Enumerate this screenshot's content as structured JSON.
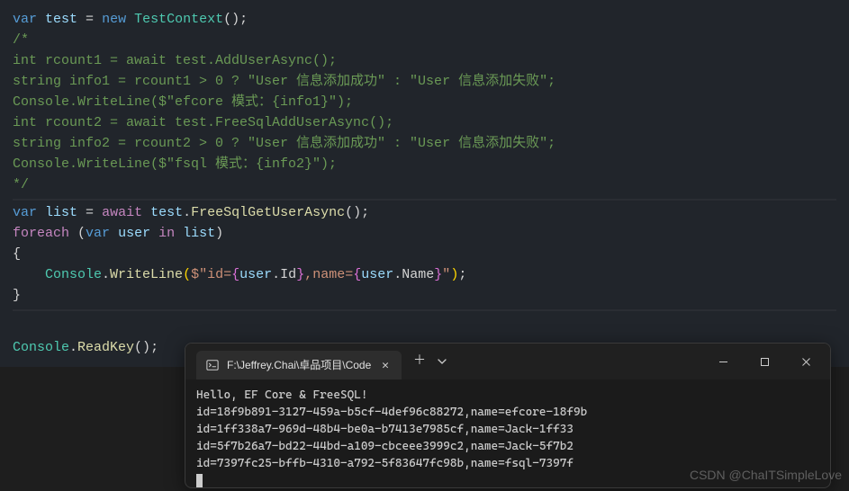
{
  "code": {
    "l1": {
      "kw_var": "var",
      "var_test": "test",
      "eq": " = ",
      "kw_new": "new",
      "cls": "TestContext",
      "parens": "()",
      "semi": ";"
    },
    "comment_open": "/*",
    "comment_lines": [
      "int rcount1 = await test.AddUserAsync();",
      "string info1 = rcount1 > 0 ? \"User 信息添加成功\" : \"User 信息添加失败\";",
      "Console.WriteLine($\"efcore 模式：{info1}\");",
      "",
      "int rcount2 = await test.FreeSqlAddUserAsync();",
      "string info2 = rcount2 > 0 ? \"User 信息添加成功\" : \"User 信息添加失败\";",
      "Console.WriteLine($\"fsql 模式：{info2}\");"
    ],
    "comment_close": "*/",
    "l_list": {
      "kw_var": "var",
      "var_list": "list",
      "eq": " = ",
      "kw_await": "await",
      "var_test": "test",
      "dot": ".",
      "method": "FreeSqlGetUserAsync",
      "parens": "()",
      "semi": ";"
    },
    "l_foreach": {
      "kw_foreach": "foreach",
      "sp": " ",
      "lp": "(",
      "kw_var": "var",
      "var_user": "user",
      "kw_in": "in",
      "var_list": "list",
      "rp": ")"
    },
    "brace_open": "{",
    "l_console": {
      "indent": "    ",
      "cls_console": "Console",
      "dot": ".",
      "method": "WriteLine",
      "lp": "(",
      "dollar": "$",
      "q1": "\"",
      "s_id": "id=",
      "lb1": "{",
      "var_user1": "user",
      "dot1": ".",
      "prop_id": "Id",
      "rb1": "}",
      "s_name": ",name=",
      "lb2": "{",
      "var_user2": "user",
      "dot2": ".",
      "prop_name": "Name",
      "rb2": "}",
      "q2": "\"",
      "rp": ")",
      "semi": ";"
    },
    "brace_close": "}",
    "l_readkey": {
      "cls_console": "Console",
      "dot": ".",
      "method": "ReadKey",
      "parens": "()",
      "semi": ";"
    }
  },
  "terminal": {
    "tab_title": "F:\\Jeffrey.Chai\\卓品项目\\Code",
    "output": [
      "Hello, EF Core & FreeSQL!",
      "id=18f9b891-3127-459a-b5cf-4def96c88272,name=efcore-18f9b",
      "id=1ff338a7-969d-48b4-be0a-b7413e7985cf,name=Jack-1ff33",
      "id=5f7b26a7-bd22-44bd-a109-cbceee3999c2,name=Jack-5f7b2",
      "id=7397fc25-bffb-4310-a792-5f83647fc98b,name=fsql-7397f"
    ]
  },
  "watermark": "CSDN @ChaITSimpleLove"
}
